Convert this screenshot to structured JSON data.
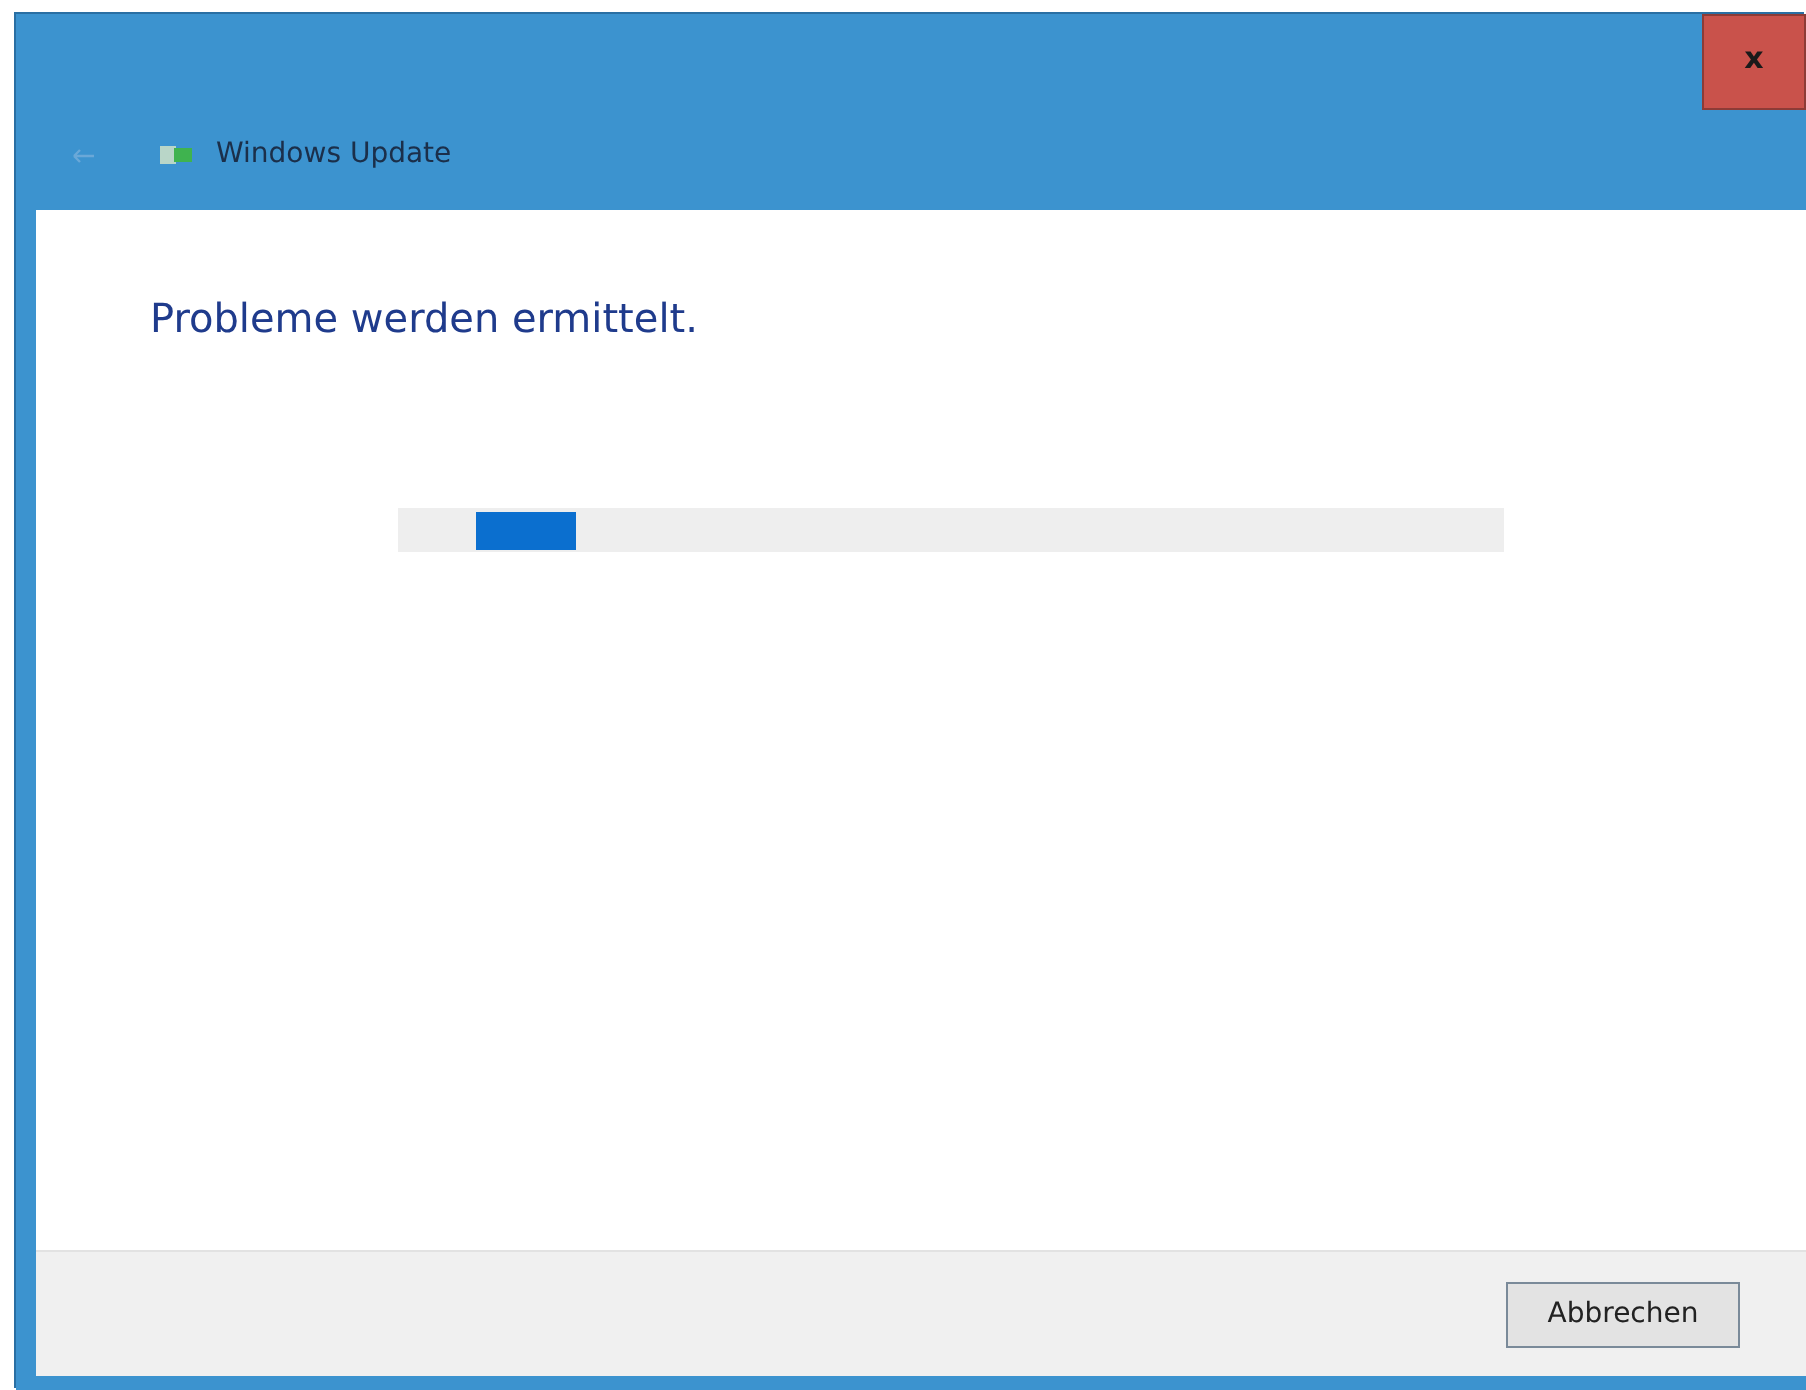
{
  "window": {
    "title": "Windows Update",
    "close_label": "x"
  },
  "heading": "Probleme werden ermittelt.",
  "progress": {
    "level": 0.09
  },
  "buttons": [
    "Abbrechen"
  ]
}
